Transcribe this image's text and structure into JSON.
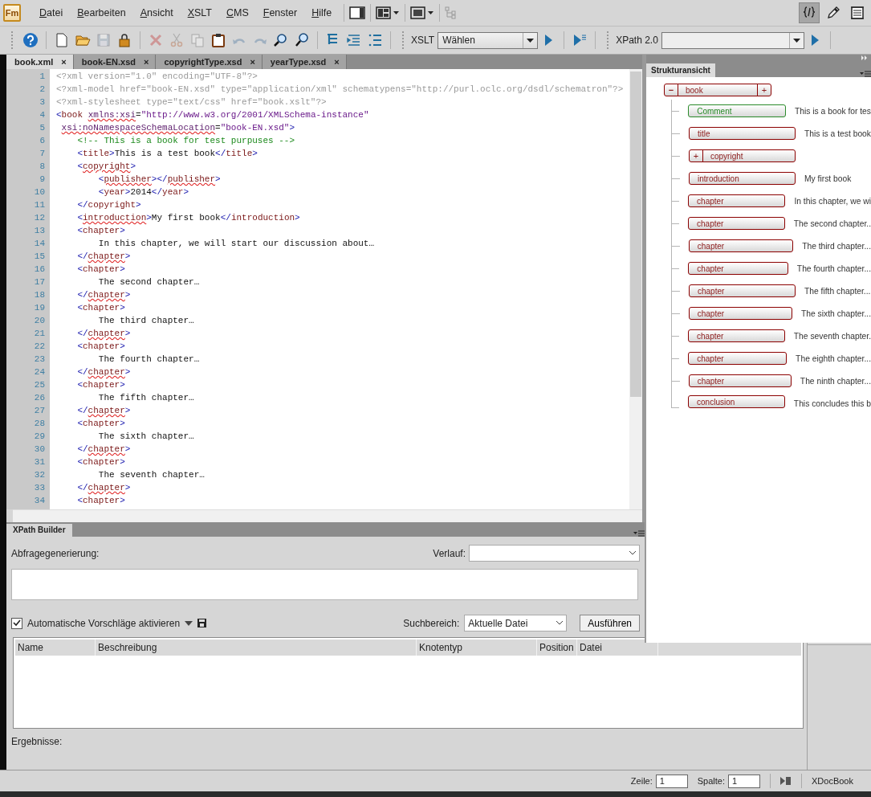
{
  "logo": "Fm",
  "menu": [
    "Datei",
    "Bearbeiten",
    "Ansicht",
    "XSLT",
    "CMS",
    "Fenster",
    "Hilfe"
  ],
  "view_modes": [
    {
      "selected": true
    },
    {
      "selected": false
    },
    {
      "selected": false
    }
  ],
  "toolbar": [
    {
      "disabled": false
    },
    {
      "disabled": false
    },
    {
      "disabled": false
    },
    {
      "disabled": true
    },
    {
      "disabled": false
    },
    {
      "disabled": true
    },
    {
      "disabled": true
    },
    {
      "disabled": true
    },
    {
      "disabled": false
    },
    {
      "disabled": true
    },
    {
      "disabled": true
    },
    {
      "disabled": false
    },
    {
      "disabled": false
    },
    {
      "disabled": false
    },
    {
      "disabled": false
    },
    {
      "disabled": false
    }
  ],
  "xslt": {
    "label": "XSLT",
    "value": "Wählen"
  },
  "xpath": {
    "label": "XPath 2.0"
  },
  "tabs": [
    {
      "label": "book.xml",
      "close": "×",
      "selected": true
    },
    {
      "label": "book-EN.xsd",
      "close": "×",
      "selected": false
    },
    {
      "label": "copyrightType.xsd",
      "close": "×",
      "selected": false
    },
    {
      "label": "yearType.xsd",
      "close": "×",
      "selected": false
    }
  ],
  "editor": {
    "lines": [
      {
        "number": "1",
        "tokens": [
          {
            "kind": "pi",
            "text": "<?xml version=\"1.0\" encoding=\"UTF-8\"?>"
          }
        ]
      },
      {
        "number": "2",
        "tokens": [
          {
            "kind": "pi",
            "text": "<?xml-model href=\"book-EN.xsd\" type=\"application/xml\" schematypens=\"http://purl.oclc.org/dsdl/schematron\"?>"
          }
        ]
      },
      {
        "number": "3",
        "tokens": [
          {
            "kind": "pi",
            "text": "<?xml-stylesheet type=\"text/css\" href=\"book.xslt\"?>"
          }
        ]
      },
      {
        "number": "4",
        "tokens": [
          {
            "kind": "punct",
            "text": "<"
          },
          {
            "kind": "name",
            "text": "book"
          },
          {
            "kind": "attr-wavy",
            "text": " xmlns:xsi"
          },
          {
            "kind": "attr",
            "text": "="
          },
          {
            "kind": "value",
            "text": "\"http://www.w3.org/2001/XMLSchema-instance\""
          }
        ]
      },
      {
        "number": "5",
        "tokens": [
          {
            "kind": "attr-wavy",
            "text": " xsi:noNamespaceSchemaLocation"
          },
          {
            "kind": "attr",
            "text": "="
          },
          {
            "kind": "value",
            "text": "\"book-EN.xsd\""
          },
          {
            "kind": "punct",
            "text": ">"
          }
        ]
      },
      {
        "number": "6",
        "tokens": [
          {
            "kind": "comment",
            "text": "    <!-- This is a book for test purpuses -->"
          }
        ]
      },
      {
        "number": "7",
        "tokens": [
          {
            "kind": "punct",
            "text": "    <"
          },
          {
            "kind": "name",
            "text": "title"
          },
          {
            "kind": "punct",
            "text": ">"
          },
          {
            "kind": "text",
            "text": "This is a test book"
          },
          {
            "kind": "punct",
            "text": "</"
          },
          {
            "kind": "name",
            "text": "title"
          },
          {
            "kind": "punct",
            "text": ">"
          }
        ]
      },
      {
        "number": "8",
        "tokens": [
          {
            "kind": "punct",
            "text": "    <"
          },
          {
            "kind": "name-wavy",
            "text": "copyright"
          },
          {
            "kind": "punct",
            "text": ">"
          }
        ]
      },
      {
        "number": "9",
        "tokens": [
          {
            "kind": "punct",
            "text": "        <"
          },
          {
            "kind": "name-wavy",
            "text": "publisher"
          },
          {
            "kind": "punct",
            "text": "></"
          },
          {
            "kind": "name-wavy",
            "text": "publisher"
          },
          {
            "kind": "punct",
            "text": ">"
          }
        ]
      },
      {
        "number": "10",
        "tokens": [
          {
            "kind": "punct",
            "text": "        <"
          },
          {
            "kind": "name",
            "text": "year"
          },
          {
            "kind": "punct",
            "text": ">"
          },
          {
            "kind": "text",
            "text": "2014"
          },
          {
            "kind": "punct",
            "text": "</"
          },
          {
            "kind": "name",
            "text": "year"
          },
          {
            "kind": "punct",
            "text": ">"
          }
        ]
      },
      {
        "number": "11",
        "tokens": [
          {
            "kind": "punct",
            "text": "    </"
          },
          {
            "kind": "name",
            "text": "copyright"
          },
          {
            "kind": "punct",
            "text": ">"
          }
        ]
      },
      {
        "number": "12",
        "tokens": [
          {
            "kind": "punct",
            "text": "    <"
          },
          {
            "kind": "name-wavy",
            "text": "introduction"
          },
          {
            "kind": "punct",
            "text": ">"
          },
          {
            "kind": "text",
            "text": "My first book"
          },
          {
            "kind": "punct",
            "text": "</"
          },
          {
            "kind": "name",
            "text": "introduction"
          },
          {
            "kind": "punct",
            "text": ">"
          }
        ]
      },
      {
        "number": "13",
        "tokens": [
          {
            "kind": "punct",
            "text": "    <"
          },
          {
            "kind": "name",
            "text": "chapter"
          },
          {
            "kind": "punct",
            "text": ">"
          }
        ]
      },
      {
        "number": "14",
        "tokens": [
          {
            "kind": "text",
            "text": "        In this chapter, we will start our discussion about…"
          }
        ]
      },
      {
        "number": "15",
        "tokens": [
          {
            "kind": "punct",
            "text": "    </"
          },
          {
            "kind": "name-wavy",
            "text": "chapter"
          },
          {
            "kind": "punct",
            "text": ">"
          }
        ]
      },
      {
        "number": "16",
        "tokens": [
          {
            "kind": "punct",
            "text": "    <"
          },
          {
            "kind": "name",
            "text": "chapter"
          },
          {
            "kind": "punct",
            "text": ">"
          }
        ]
      },
      {
        "number": "17",
        "tokens": [
          {
            "kind": "text",
            "text": "        The second chapter…"
          }
        ]
      },
      {
        "number": "18",
        "tokens": [
          {
            "kind": "punct",
            "text": "    </"
          },
          {
            "kind": "name-wavy",
            "text": "chapter"
          },
          {
            "kind": "punct",
            "text": ">"
          }
        ]
      },
      {
        "number": "19",
        "tokens": [
          {
            "kind": "punct",
            "text": "    <"
          },
          {
            "kind": "name",
            "text": "chapter"
          },
          {
            "kind": "punct",
            "text": ">"
          }
        ]
      },
      {
        "number": "20",
        "tokens": [
          {
            "kind": "text",
            "text": "        The third chapter…"
          }
        ]
      },
      {
        "number": "21",
        "tokens": [
          {
            "kind": "punct",
            "text": "    </"
          },
          {
            "kind": "name-wavy",
            "text": "chapter"
          },
          {
            "kind": "punct",
            "text": ">"
          }
        ]
      },
      {
        "number": "22",
        "tokens": [
          {
            "kind": "punct",
            "text": "    <"
          },
          {
            "kind": "name",
            "text": "chapter"
          },
          {
            "kind": "punct",
            "text": ">"
          }
        ]
      },
      {
        "number": "23",
        "tokens": [
          {
            "kind": "text",
            "text": "        The fourth chapter…"
          }
        ]
      },
      {
        "number": "24",
        "tokens": [
          {
            "kind": "punct",
            "text": "    </"
          },
          {
            "kind": "name-wavy",
            "text": "chapter"
          },
          {
            "kind": "punct",
            "text": ">"
          }
        ]
      },
      {
        "number": "25",
        "tokens": [
          {
            "kind": "punct",
            "text": "    <"
          },
          {
            "kind": "name",
            "text": "chapter"
          },
          {
            "kind": "punct",
            "text": ">"
          }
        ]
      },
      {
        "number": "26",
        "tokens": [
          {
            "kind": "text",
            "text": "        The fifth chapter…"
          }
        ]
      },
      {
        "number": "27",
        "tokens": [
          {
            "kind": "punct",
            "text": "    </"
          },
          {
            "kind": "name-wavy",
            "text": "chapter"
          },
          {
            "kind": "punct",
            "text": ">"
          }
        ]
      },
      {
        "number": "28",
        "tokens": [
          {
            "kind": "punct",
            "text": "    <"
          },
          {
            "kind": "name",
            "text": "chapter"
          },
          {
            "kind": "punct",
            "text": ">"
          }
        ]
      },
      {
        "number": "29",
        "tokens": [
          {
            "kind": "text",
            "text": "        The sixth chapter…"
          }
        ]
      },
      {
        "number": "30",
        "tokens": [
          {
            "kind": "punct",
            "text": "    </"
          },
          {
            "kind": "name-wavy",
            "text": "chapter"
          },
          {
            "kind": "punct",
            "text": ">"
          }
        ]
      },
      {
        "number": "31",
        "tokens": [
          {
            "kind": "punct",
            "text": "    <"
          },
          {
            "kind": "name",
            "text": "chapter"
          },
          {
            "kind": "punct",
            "text": ">"
          }
        ]
      },
      {
        "number": "32",
        "tokens": [
          {
            "kind": "text",
            "text": "        The seventh chapter…"
          }
        ]
      },
      {
        "number": "33",
        "tokens": [
          {
            "kind": "punct",
            "text": "    </"
          },
          {
            "kind": "name-wavy",
            "text": "chapter"
          },
          {
            "kind": "punct",
            "text": ">"
          }
        ]
      },
      {
        "number": "34",
        "tokens": [
          {
            "kind": "punct",
            "text": "    <"
          },
          {
            "kind": "name",
            "text": "chapter"
          },
          {
            "kind": "punct",
            "text": ">"
          }
        ]
      }
    ]
  },
  "structure": {
    "title": "Strukturansicht",
    "root": {
      "label": "book",
      "kind": "branch",
      "toggle": "−",
      "expanded": true,
      "add": "+",
      "children": [
        {
          "label": "Comment",
          "kind": "comment",
          "value": "This is a book for tes"
        },
        {
          "label": "title",
          "kind": "leaf",
          "value": "This is a test book"
        },
        {
          "label": "copyright",
          "kind": "branch",
          "toggle": "+",
          "expanded": false
        },
        {
          "label": "introduction",
          "kind": "leaf",
          "value": "My first book"
        },
        {
          "label": "chapter",
          "kind": "leaf",
          "value": "In this chapter, we wi"
        },
        {
          "label": "chapter",
          "kind": "leaf",
          "value": "The second chapter.."
        },
        {
          "label": "chapter",
          "kind": "leaf",
          "value": "The third chapter..."
        },
        {
          "label": "chapter",
          "kind": "leaf",
          "value": "The fourth chapter..."
        },
        {
          "label": "chapter",
          "kind": "leaf",
          "value": "The fifth chapter..."
        },
        {
          "label": "chapter",
          "kind": "leaf",
          "value": "The sixth chapter..."
        },
        {
          "label": "chapter",
          "kind": "leaf",
          "value": "The seventh chapter."
        },
        {
          "label": "chapter",
          "kind": "leaf",
          "value": "The eighth chapter..."
        },
        {
          "label": "chapter",
          "kind": "leaf",
          "value": "The ninth chapter..."
        },
        {
          "label": "conclusion",
          "kind": "leaf",
          "value": "This concludes this b"
        }
      ]
    }
  },
  "xpath_builder": {
    "title": "XPath Builder",
    "query_label": "Abfragegenerierung:",
    "history_label": "Verlauf:",
    "auto_suggest": {
      "label": "Automatische Vorschläge aktivieren",
      "checked": true
    },
    "scope_label": "Suchbereich:",
    "scope_value": "Aktuelle Datei",
    "run_button": "Ausführen",
    "columns": [
      "Name",
      "Beschreibung",
      "Knotentyp",
      "Position",
      "Datei"
    ],
    "results_label": "Ergebnisse:"
  },
  "status_bar": {
    "line_label": "Zeile:",
    "line": "1",
    "column_label": "Spalte:",
    "column": "1",
    "schema": "XDocBook"
  }
}
